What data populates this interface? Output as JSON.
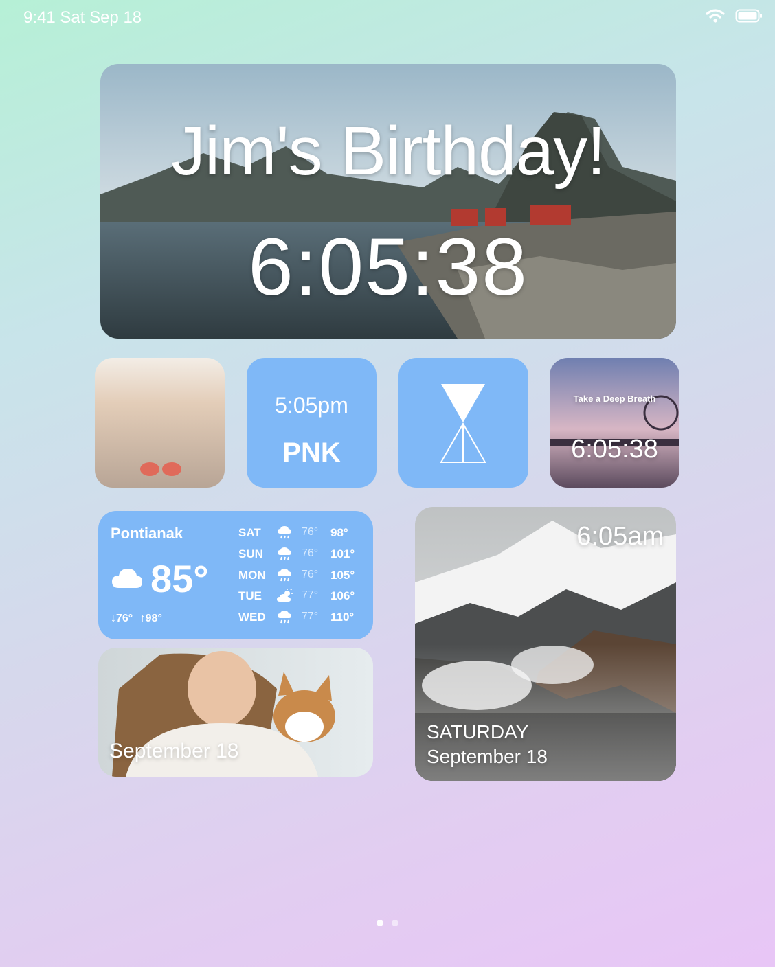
{
  "status_bar": {
    "time_date": "9:41  Sat Sep 18",
    "wifi_icon": "wifi-icon",
    "battery_icon": "battery-icon"
  },
  "birthday_widget": {
    "title": "Jim's Birthday!",
    "countdown": "6:05:38"
  },
  "clock_widget": {
    "time": "5:05pm",
    "city_code": "PNK"
  },
  "hourglass_widget": {
    "icon": "hourglass-icon"
  },
  "breath_widget": {
    "label": "Take a Deep Breath",
    "time": "6:05:38"
  },
  "weather_widget": {
    "city": "Pontianak",
    "current_temp": "85°",
    "low": "76°",
    "high": "98°",
    "forecast": [
      {
        "day": "SAT",
        "icon": "rain-cloud-icon",
        "low": "76°",
        "high": "98°"
      },
      {
        "day": "SUN",
        "icon": "rain-cloud-icon",
        "low": "76°",
        "high": "101°"
      },
      {
        "day": "MON",
        "icon": "rain-cloud-icon",
        "low": "76°",
        "high": "105°"
      },
      {
        "day": "TUE",
        "icon": "sun-cloud-icon",
        "low": "77°",
        "high": "106°"
      },
      {
        "day": "WED",
        "icon": "rain-cloud-icon",
        "low": "77°",
        "high": "110°"
      }
    ]
  },
  "photo_date_widget": {
    "date": "September 18"
  },
  "mountain_widget": {
    "time": "6:05am",
    "weekday": "SATURDAY",
    "date": "September 18"
  },
  "page_indicator": {
    "pages": 2,
    "current": 1
  }
}
